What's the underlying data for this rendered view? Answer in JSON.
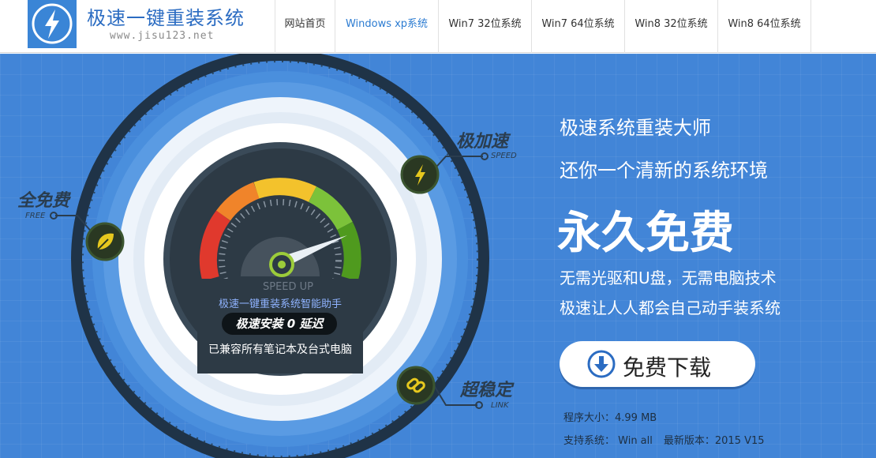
{
  "header": {
    "logo_icon": "lightning-bolt-icon",
    "site_title": "极速一键重装系统",
    "site_url": "www.jisu123.net",
    "nav": [
      {
        "label": "网站首页"
      },
      {
        "label": "Windows xp系统"
      },
      {
        "label": "Win7 32位系统"
      },
      {
        "label": "Win7 64位系统"
      },
      {
        "label": "Win8 32位系统"
      },
      {
        "label": "Win8 64位系统"
      }
    ],
    "active_nav": "Windows xp系统"
  },
  "gauge": {
    "features": {
      "free": {
        "cn": "全免费",
        "en": "FREE",
        "icon": "leaf-icon"
      },
      "speed": {
        "cn": "极加速",
        "en": "SPEED",
        "icon": "lightning-icon"
      },
      "stable": {
        "cn": "超稳定",
        "en": "LINK",
        "icon": "link-icon"
      }
    },
    "speed_up": "SPEED UP",
    "assistant": "极速一键重装系统智能助手",
    "pill": "极速安装 0 延迟",
    "compat": "已兼容所有笔记本及台式电脑"
  },
  "promo": {
    "heading1": "极速系统重装大师",
    "heading2": "还你一个清新的系统环境",
    "big": "永久免费",
    "desc1": "无需光驱和U盘，无需电脑技术",
    "desc2": "极速让人人都会自己动手装系统",
    "download_label": "免费下载",
    "download_icon": "download-arrow-icon",
    "size_text": "程序大小：4.99 MB",
    "support_text": "支持系统： Win all",
    "version_text": "最新版本：2015 V15"
  },
  "colors": {
    "banner_bg": "#4285d7",
    "header_accent": "#2b6cc2",
    "gauge_face": "#2d3a45",
    "feature_badge": "#2a3822",
    "feature_icon": "#e6c81e"
  }
}
